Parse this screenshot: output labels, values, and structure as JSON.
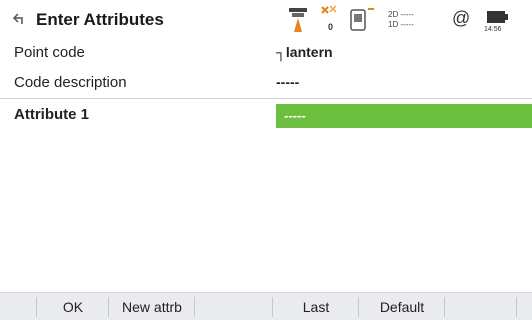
{
  "title": "Enter Attributes",
  "status": {
    "gnss_icon": "gnss-rover-icon",
    "satellites_count": "0",
    "precision_2d": "2D -----",
    "precision_1d": "1D -----",
    "at_symbol": "@",
    "time": "14:56"
  },
  "fields": {
    "point_code_label": "Point code",
    "point_code_value": "┐lantern",
    "code_description_label": "Code description",
    "code_description_value": "-----",
    "attribute1_label": "Attribute 1",
    "attribute1_value": "-----"
  },
  "softkeys": {
    "ok": "OK",
    "new_attrb": "New attrb",
    "last": "Last",
    "default": "Default"
  },
  "colors": {
    "accent_green": "#6cbf3f",
    "softkey_bg": "#e9ebee"
  }
}
